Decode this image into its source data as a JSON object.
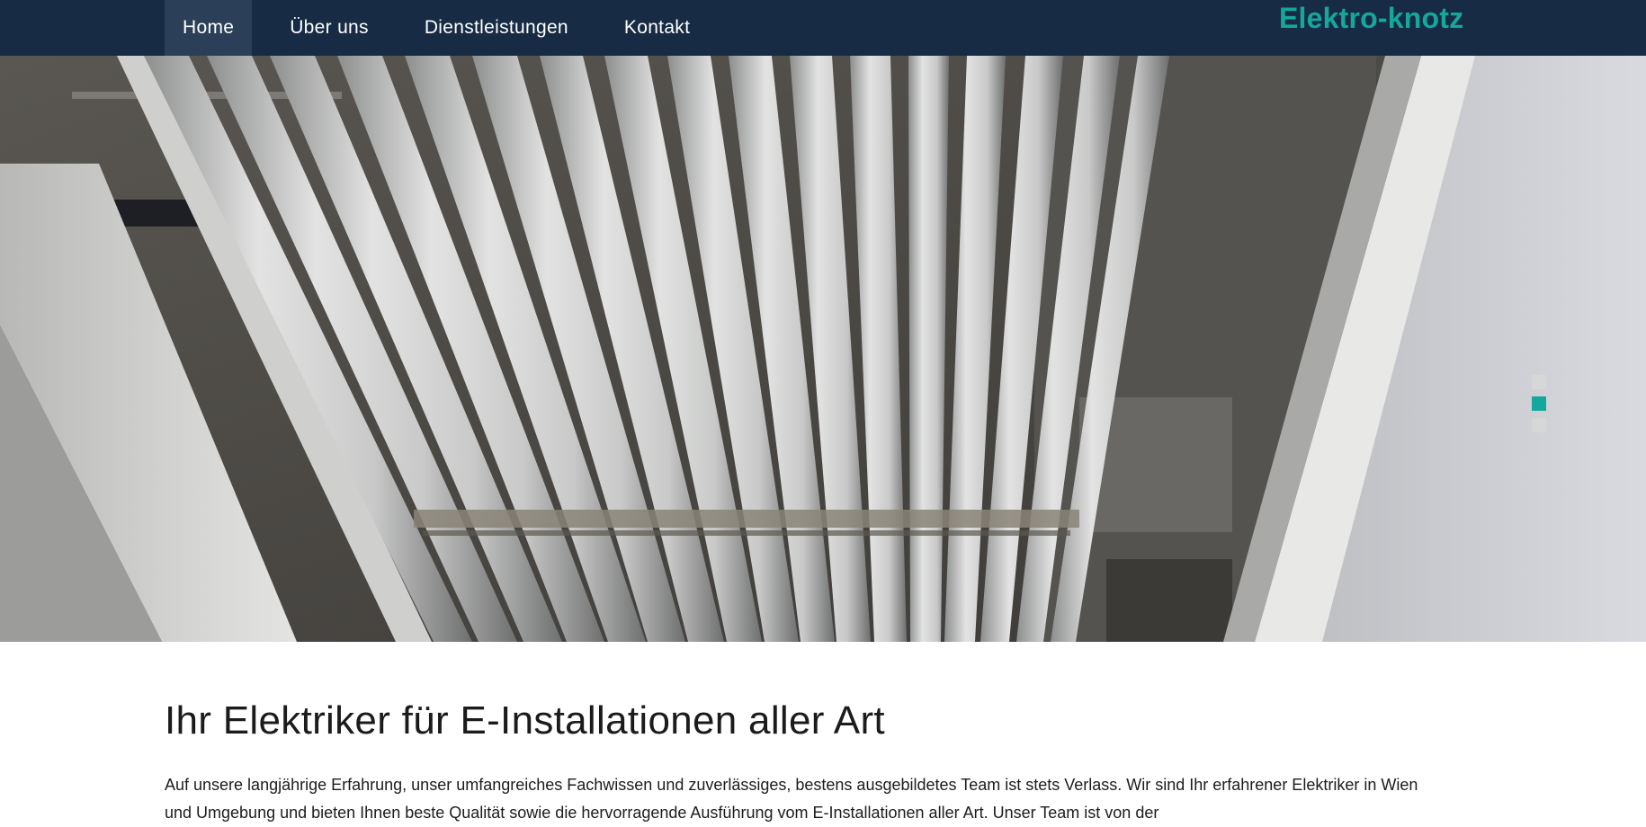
{
  "nav": {
    "items": [
      {
        "label": "Home",
        "active": true
      },
      {
        "label": "Über uns",
        "active": false
      },
      {
        "label": "Dienstleistungen",
        "active": false
      },
      {
        "label": "Kontakt",
        "active": false
      }
    ]
  },
  "brand": {
    "name": "Elektro-knotz"
  },
  "hero": {
    "slider": {
      "slide_count": 3,
      "active_index": 1
    }
  },
  "main": {
    "headline": "Ihr Elektriker für E-Installationen aller Art",
    "lead": "Auf unsere langjährige Erfahrung, unser umfangreiches Fachwissen und zuverlässiges, bestens ausgebildetes Team ist stets Verlass. Wir sind Ihr erfahrener Elektriker in Wien und Umgebung und bieten Ihnen beste Qualität sowie die hervorragende Ausführung vom E-Installationen aller Art. Unser Team ist von der"
  },
  "colors": {
    "nav_background": "#172b44",
    "nav_active": "#2b3f58",
    "accent": "#14a89c"
  }
}
